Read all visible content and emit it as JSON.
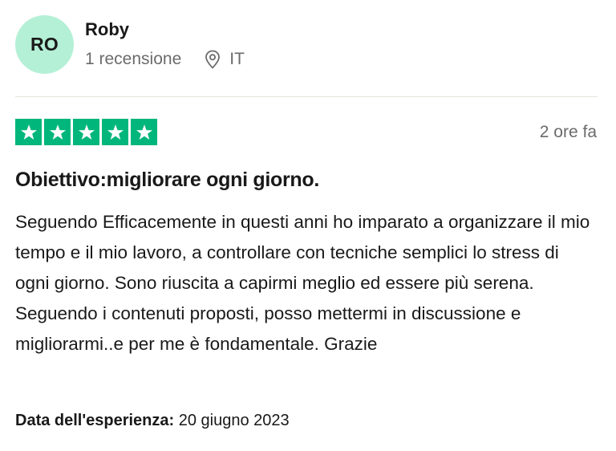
{
  "reviewer": {
    "initials": "RO",
    "name": "Roby",
    "reviews_count": "1 recensione",
    "country": "IT",
    "avatar_color": "#b4f0d6"
  },
  "rating": {
    "stars": 5,
    "max": 5,
    "star_color": "#00b67a"
  },
  "review": {
    "time_ago": "2 ore fa",
    "title": "Obiettivo:migliorare ogni giorno.",
    "body": "Seguendo Efficacemente in questi anni ho imparato a organizzare il mio tempo e il mio lavoro, a controllare con tecniche semplici lo stress di ogni giorno. Sono riuscita a capirmi meglio ed essere più serena. Seguendo i contenuti proposti, posso mettermi in discussione e migliorarmi..e per me è fondamentale. Grazie",
    "experience_label": "Data dell'esperienza:",
    "experience_date": "20 giugno 2023"
  },
  "icons": {
    "location": "location-pin-icon",
    "star": "star-icon"
  }
}
